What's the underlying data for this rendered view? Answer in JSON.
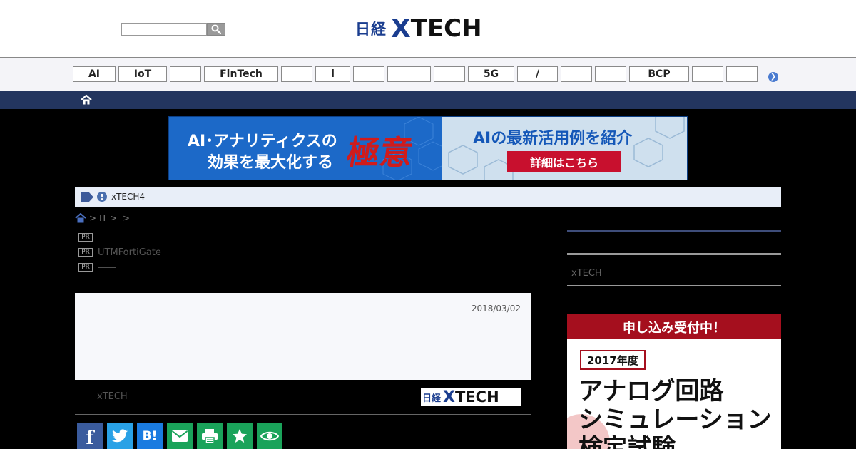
{
  "header": {
    "search_placeholder": "",
    "logo": {
      "prefix": "日経",
      "x": "X",
      "suffix": "TECH"
    }
  },
  "nav": {
    "items": [
      "AI",
      "IoT",
      "",
      "FinTech",
      "",
      "i",
      "",
      "",
      "",
      "5G",
      "/",
      "",
      "",
      "BCP",
      "",
      ""
    ]
  },
  "banner": {
    "line1": "AI･アナリティクスの",
    "line2": "効果を最大化する",
    "kanji": "極意",
    "right_line": "AIの最新活用例を紹介",
    "cta": "詳細はこちら"
  },
  "notice": {
    "icon": "!",
    "text": "xTECH4"
  },
  "breadcrumb": {
    "items": [
      ">",
      "IT",
      ">",
      "",
      ">"
    ]
  },
  "pr_items": [
    {
      "badge": "PR",
      "text": ""
    },
    {
      "badge": "PR",
      "text": "UTMFortiGate"
    },
    {
      "badge": "PR",
      "text": "――"
    }
  ],
  "article": {
    "date": "2018/03/02"
  },
  "byline": {
    "source": "xTECH",
    "logo": {
      "prefix": "日経",
      "x": "X",
      "suffix": "TECH"
    }
  },
  "social": {
    "facebook": "f",
    "hatena": "B!"
  },
  "sidebar": {
    "xtech_label": "xTECH"
  },
  "side_ad": {
    "header": "申し込み受付中！",
    "year": "2017年度",
    "line1": "アナログ回路",
    "line2": "シミュレーション",
    "line3": "検定試験"
  }
}
